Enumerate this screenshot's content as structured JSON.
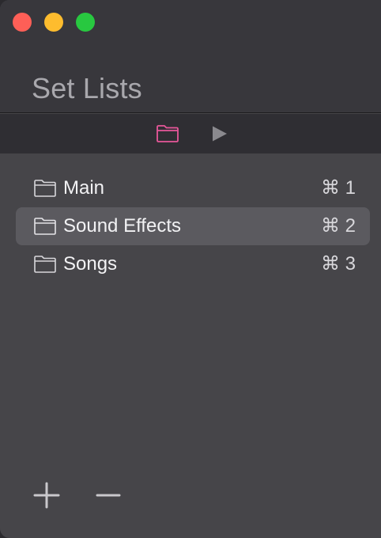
{
  "window": {
    "title": "Set Lists"
  },
  "toolbar": {
    "folder_icon": "folder-icon",
    "play_icon": "play-icon",
    "accent": "#e8579a"
  },
  "set_lists": [
    {
      "label": "Main",
      "shortcut": "⌘ 1",
      "icon": "folder-icon",
      "selected": false
    },
    {
      "label": "Sound Effects",
      "shortcut": "⌘ 2",
      "icon": "folder-icon",
      "selected": true
    },
    {
      "label": "Songs",
      "shortcut": "⌘ 3",
      "icon": "folder-icon",
      "selected": false
    }
  ],
  "footer": {
    "add_icon": "plus-icon",
    "remove_icon": "minus-icon"
  },
  "colors": {
    "close": "#fe5f57",
    "minimize": "#febc2e",
    "zoom": "#28c840",
    "selection": "#5b5a5f"
  }
}
